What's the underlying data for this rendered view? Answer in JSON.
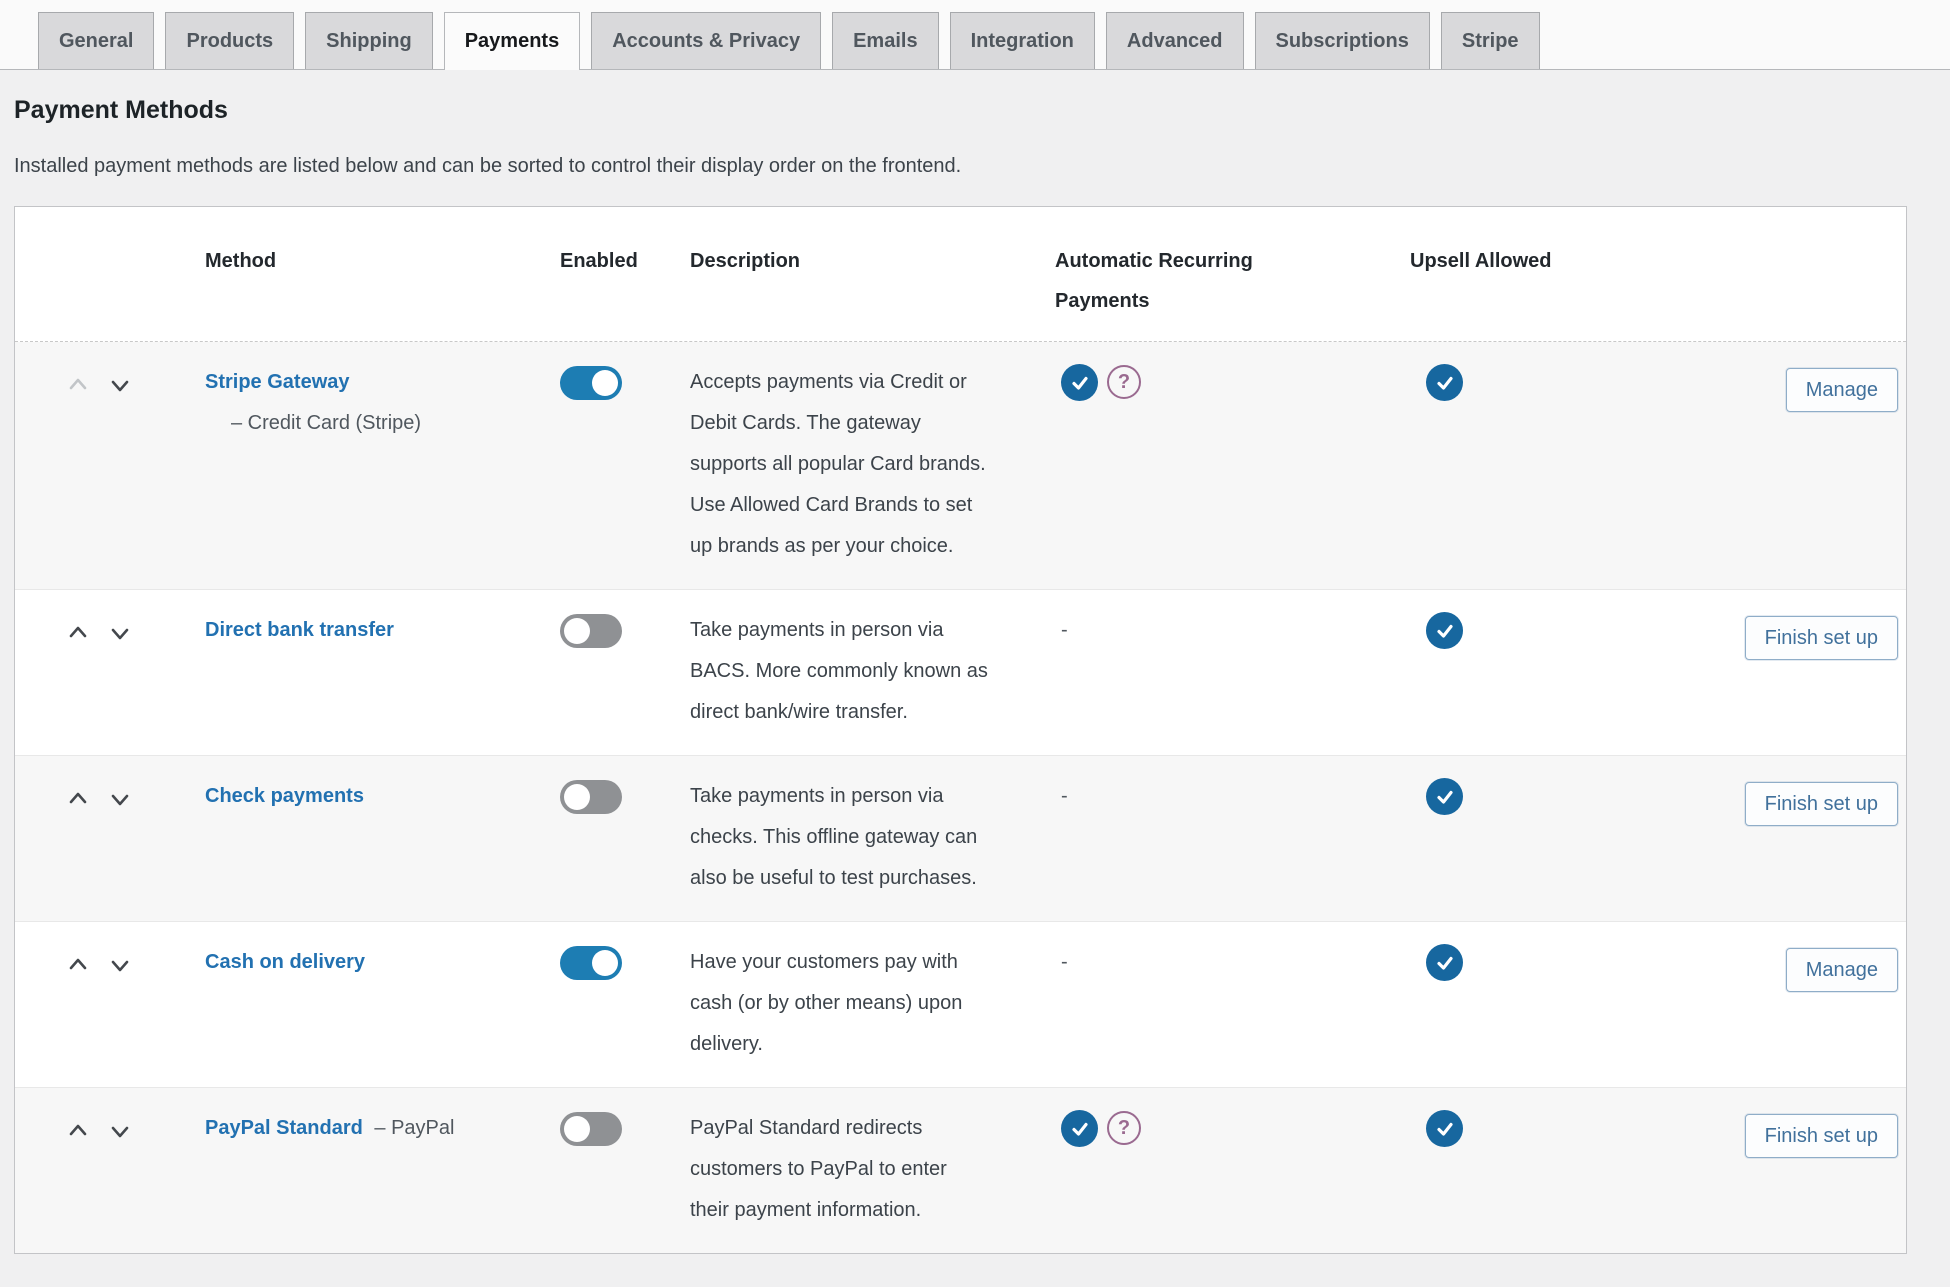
{
  "colors": {
    "link_blue": "#2271b1",
    "toggle_on_blue": "#1d7db3",
    "toggle_off_gray": "#8f9194",
    "check_circle_blue": "#17679f",
    "help_circle_purple": "#9a6a90",
    "button_text_blue": "#41719c",
    "button_border_blue": "#8fadc8",
    "tab_inactive_bg": "#d9d9db",
    "row_stripe_bg": "#f7f7f7"
  },
  "tabs": {
    "items": [
      {
        "label": "General",
        "active": false
      },
      {
        "label": "Products",
        "active": false
      },
      {
        "label": "Shipping",
        "active": false
      },
      {
        "label": "Payments",
        "active": true
      },
      {
        "label": "Accounts & Privacy",
        "active": false
      },
      {
        "label": "Emails",
        "active": false
      },
      {
        "label": "Integration",
        "active": false
      },
      {
        "label": "Advanced",
        "active": false
      },
      {
        "label": "Subscriptions",
        "active": false
      },
      {
        "label": "Stripe",
        "active": false
      }
    ]
  },
  "page": {
    "title": "Payment Methods",
    "subtitle": "Installed payment methods are listed below and can be sorted to control their display order on the frontend."
  },
  "table": {
    "headers": {
      "method": "Method",
      "enabled": "Enabled",
      "description": "Description",
      "recurring": "Automatic Recurring Payments",
      "upsell": "Upsell Allowed"
    },
    "rows": [
      {
        "method": "Stripe Gateway",
        "method_suffix": "– Credit Card (Stripe)",
        "suffix_layout": "block",
        "enabled": true,
        "description": [
          "Accepts payments via Credit or Debit Cards. The gateway supports all popular Card brands.",
          "Use Allowed Card Brands to set up brands as per your choice."
        ],
        "recurring": {
          "check": true,
          "question": true,
          "dash": false
        },
        "upsell": true,
        "action": "Manage",
        "up_disabled": true
      },
      {
        "method": "Direct bank transfer",
        "method_suffix": "",
        "suffix_layout": "none",
        "enabled": false,
        "description": [
          "Take payments in person via BACS. More commonly known as direct bank/wire transfer."
        ],
        "recurring": {
          "check": false,
          "question": false,
          "dash": true
        },
        "upsell": true,
        "action": "Finish set up",
        "up_disabled": false
      },
      {
        "method": "Check payments",
        "method_suffix": "",
        "suffix_layout": "none",
        "enabled": false,
        "description": [
          "Take payments in person via checks. This offline gateway can also be useful to test purchases."
        ],
        "recurring": {
          "check": false,
          "question": false,
          "dash": true
        },
        "upsell": true,
        "action": "Finish set up",
        "up_disabled": false
      },
      {
        "method": "Cash on delivery",
        "method_suffix": "",
        "suffix_layout": "none",
        "enabled": true,
        "description": [
          "Have your customers pay with cash (or by other means) upon delivery."
        ],
        "recurring": {
          "check": false,
          "question": false,
          "dash": true
        },
        "upsell": true,
        "action": "Manage",
        "up_disabled": false
      },
      {
        "method": "PayPal Standard",
        "method_suffix": "– PayPal",
        "suffix_layout": "inline",
        "enabled": false,
        "description": [
          "PayPal Standard redirects customers to PayPal to enter their payment information."
        ],
        "recurring": {
          "check": true,
          "question": true,
          "dash": false
        },
        "upsell": true,
        "action": "Finish set up",
        "up_disabled": false
      }
    ]
  },
  "icons": {
    "drag_handle": "drag-handle-icon",
    "move_up": "chevron-up-icon",
    "move_down": "chevron-down-icon",
    "check": "checkmark-circle-icon",
    "question_glyph": "?",
    "dash_glyph": "-"
  }
}
